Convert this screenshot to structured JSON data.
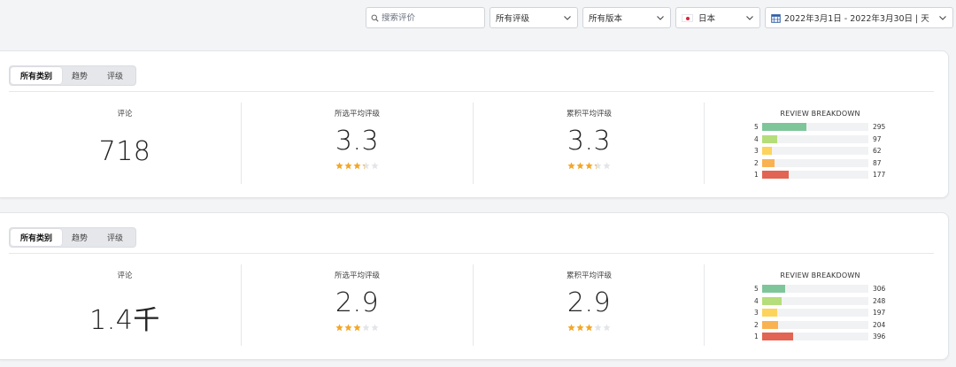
{
  "filters": {
    "search_placeholder": "搜索评价",
    "rating": "所有评级",
    "version": "所有版本",
    "country": "日本",
    "date_range": "2022年3月1日 - 2022年3月30日 | 天"
  },
  "colors": {
    "star_fill": "#f5a623",
    "star_empty": "#e3e5e8",
    "bar_5": "#7ec69a",
    "bar_4": "#b5dd7a",
    "bar_3": "#fcd45c",
    "bar_2": "#f9b252",
    "bar_1": "#e26452"
  },
  "panels": [
    {
      "tabs": [
        "所有类别",
        "趋势",
        "评级"
      ],
      "active_tab": 0,
      "reviews_label": "评论",
      "reviews_value": "718",
      "selected_avg_label": "所选平均评级",
      "selected_avg_value": "3.3",
      "cumulative_avg_label": "累积平均评级",
      "cumulative_avg_value": "3.3",
      "breakdown_title": "REVIEW BREAKDOWN",
      "breakdown": [
        {
          "stars": "5",
          "count": "295",
          "fraction": 0.42
        },
        {
          "stars": "4",
          "count": "97",
          "fraction": 0.14
        },
        {
          "stars": "3",
          "count": "62",
          "fraction": 0.09
        },
        {
          "stars": "2",
          "count": "87",
          "fraction": 0.12
        },
        {
          "stars": "1",
          "count": "177",
          "fraction": 0.25
        }
      ]
    },
    {
      "tabs": [
        "所有类别",
        "趋势",
        "评级"
      ],
      "active_tab": 0,
      "reviews_label": "评论",
      "reviews_value": "1.4千",
      "selected_avg_label": "所选平均评级",
      "selected_avg_value": "2.9",
      "cumulative_avg_label": "累积平均评级",
      "cumulative_avg_value": "2.9",
      "breakdown_title": "REVIEW BREAKDOWN",
      "breakdown": [
        {
          "stars": "5",
          "count": "306",
          "fraction": 0.22
        },
        {
          "stars": "4",
          "count": "248",
          "fraction": 0.18
        },
        {
          "stars": "3",
          "count": "197",
          "fraction": 0.14
        },
        {
          "stars": "2",
          "count": "204",
          "fraction": 0.15
        },
        {
          "stars": "1",
          "count": "396",
          "fraction": 0.29
        }
      ]
    }
  ]
}
